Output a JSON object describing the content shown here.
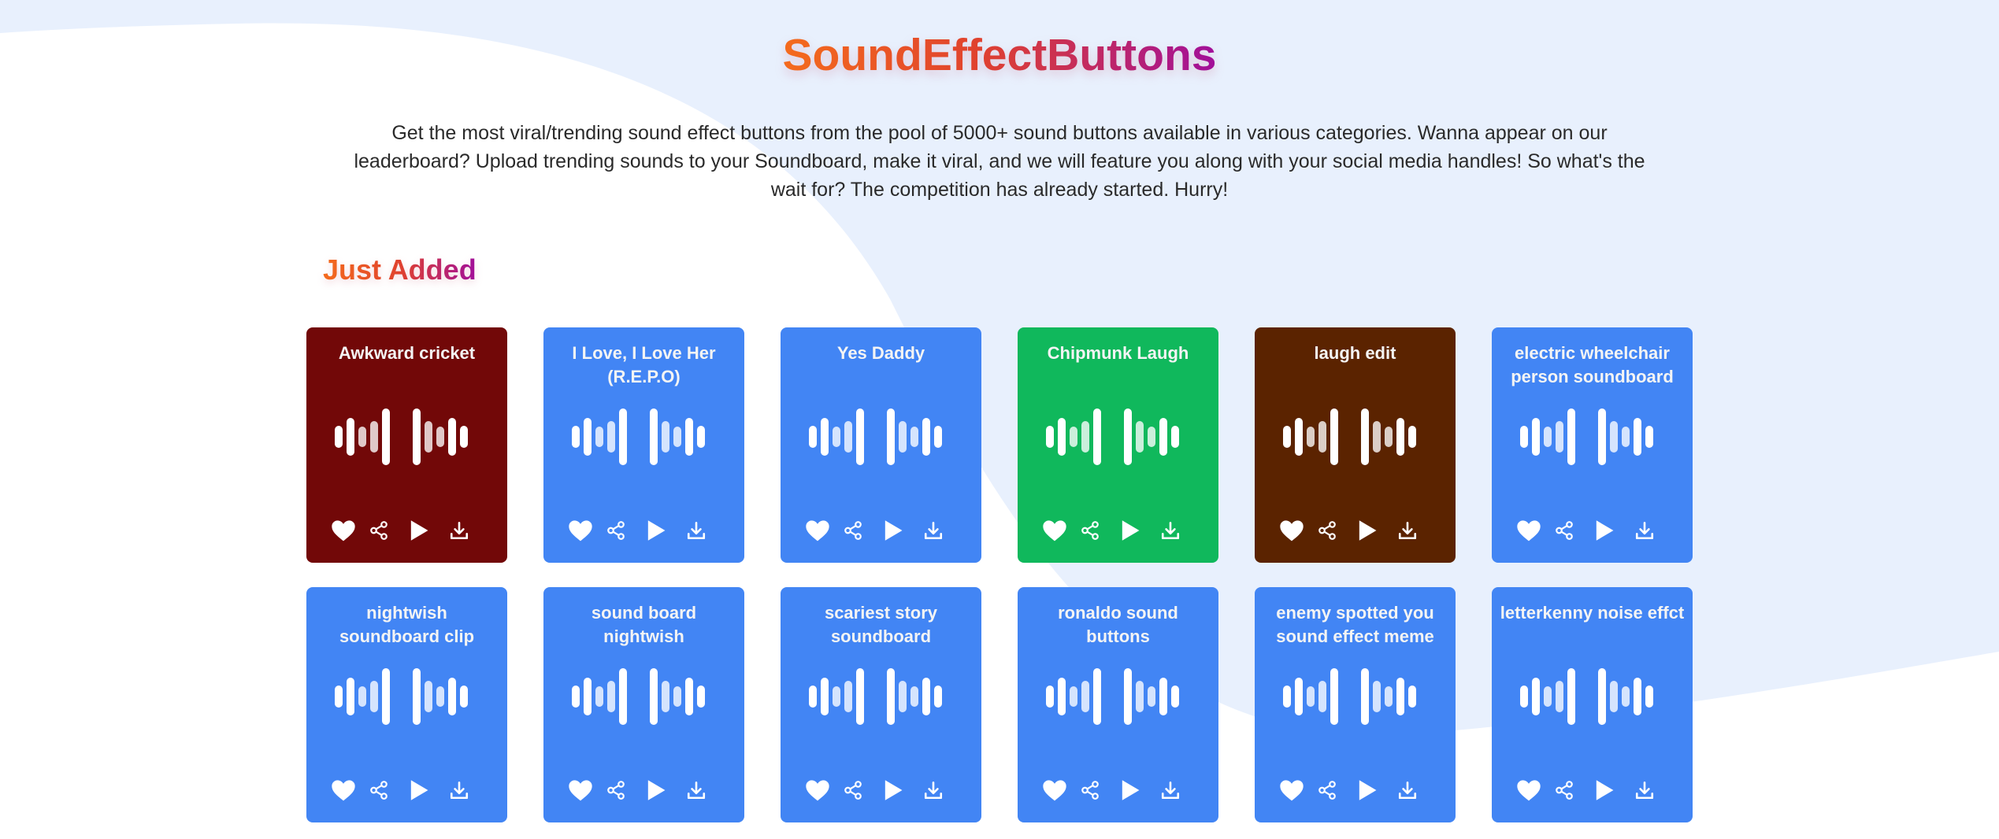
{
  "header": {
    "title": "SoundEffectButtons",
    "description": "Get the most viral/trending sound effect buttons from the pool of 5000+ sound buttons available in various categories. Wanna appear on our leaderboard? Upload trending sounds to your Soundboard, make it viral, and we will feature you along with your social media handles! So what's the wait for? The competition has already started. Hurry!"
  },
  "section": {
    "title": "Just Added"
  },
  "colors": {
    "blue": "#4285f4",
    "maroon": "#720808",
    "green": "#10b85c",
    "brown": "#5b2300",
    "title_gradient_start": "#f46b1d",
    "title_gradient_end": "#a10f9a"
  },
  "icons": [
    "heart-icon",
    "share-icon",
    "play-icon",
    "download-icon"
  ],
  "cards": [
    {
      "title": "Awkward cricket",
      "color": "#720808"
    },
    {
      "title": "I Love, I Love Her (R.E.P.O)",
      "color": "#4285f4"
    },
    {
      "title": "Yes Daddy",
      "color": "#4285f4"
    },
    {
      "title": "Chipmunk Laugh",
      "color": "#10b85c"
    },
    {
      "title": "laugh edit",
      "color": "#5b2300"
    },
    {
      "title": "electric wheelchair person soundboard",
      "color": "#4285f4"
    },
    {
      "title": "nightwish soundboard clip",
      "color": "#4285f4"
    },
    {
      "title": "sound board nightwish",
      "color": "#4285f4"
    },
    {
      "title": "scariest story soundboard",
      "color": "#4285f4"
    },
    {
      "title": "ronaldo sound buttons",
      "color": "#4285f4"
    },
    {
      "title": "enemy spotted you sound effect meme",
      "color": "#4285f4"
    },
    {
      "title": "letterkenny noise effct",
      "color": "#4285f4"
    }
  ]
}
